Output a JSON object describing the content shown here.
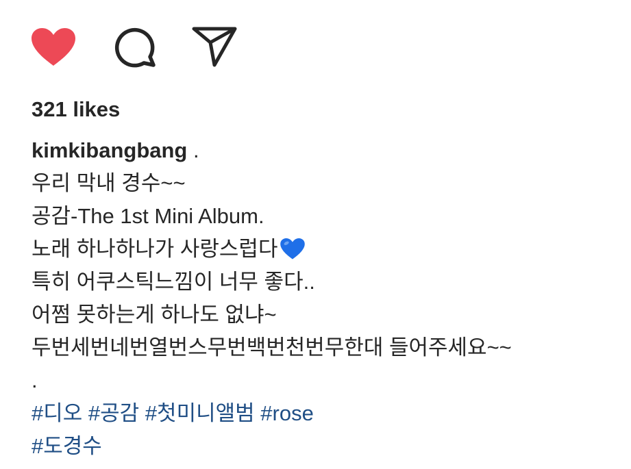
{
  "actions": {
    "like_icon": "heart-filled-icon",
    "comment_icon": "speech-bubble-icon",
    "share_icon": "paper-plane-icon",
    "like_color": "#ed4956"
  },
  "post": {
    "likes_text": "321 likes",
    "username": "kimkibangbang",
    "caption_lines": [
      " .",
      "우리 막내 경수~~",
      "공감-The 1st Mini Album.",
      "노래 하나하나가 사랑스럽다",
      "특히 어쿠스틱느낌이 너무 좋다..",
      "어쩜 못하는게 하나도 없냐~",
      "두번세번네번열번스무번백번천번무한대 들어주세요~~",
      "."
    ],
    "emoji": "blue-heart-emoji",
    "emoji_color": "#1f6fe8",
    "hashtags": [
      "#디오",
      "#공감",
      "#첫미니앨범",
      "#rose",
      "#도경수"
    ]
  }
}
